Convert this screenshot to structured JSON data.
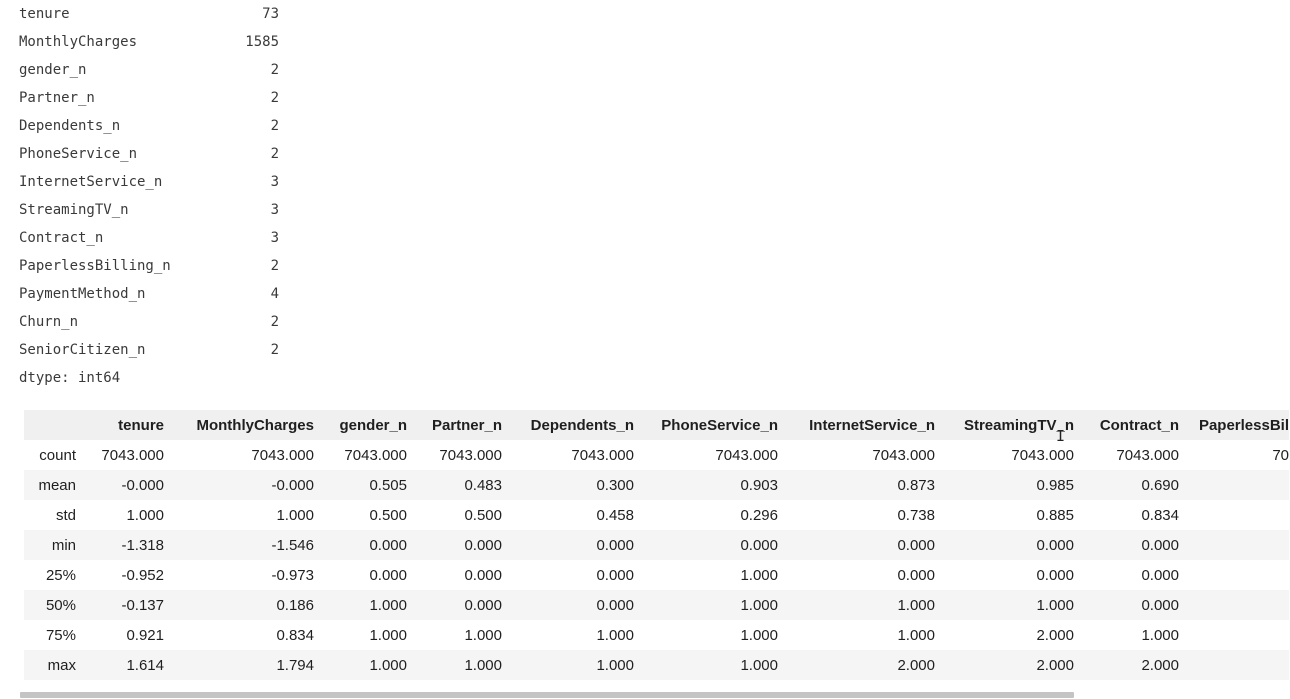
{
  "series_output": {
    "rows": [
      {
        "name": "tenure",
        "value": "73"
      },
      {
        "name": "MonthlyCharges",
        "value": "1585"
      },
      {
        "name": "gender_n",
        "value": "2"
      },
      {
        "name": "Partner_n",
        "value": "2"
      },
      {
        "name": "Dependents_n",
        "value": "2"
      },
      {
        "name": "PhoneService_n",
        "value": "2"
      },
      {
        "name": "InternetService_n",
        "value": "3"
      },
      {
        "name": "StreamingTV_n",
        "value": "3"
      },
      {
        "name": "Contract_n",
        "value": "3"
      },
      {
        "name": "PaperlessBilling_n",
        "value": "2"
      },
      {
        "name": "PaymentMethod_n",
        "value": "4"
      },
      {
        "name": "Churn_n",
        "value": "2"
      },
      {
        "name": "SeniorCitizen_n",
        "value": "2"
      }
    ],
    "dtype": "dtype: int64"
  },
  "dataframe": {
    "columns": [
      "tenure",
      "MonthlyCharges",
      "gender_n",
      "Partner_n",
      "Dependents_n",
      "PhoneService_n",
      "InternetService_n",
      "StreamingTV_n",
      "Contract_n",
      "PaperlessBil"
    ],
    "rows": [
      {
        "index": "count",
        "cells": [
          "7043.000",
          "7043.000",
          "7043.000",
          "7043.000",
          "7043.000",
          "7043.000",
          "7043.000",
          "7043.000",
          "7043.000",
          "70"
        ]
      },
      {
        "index": "mean",
        "cells": [
          "-0.000",
          "-0.000",
          "0.505",
          "0.483",
          "0.300",
          "0.903",
          "0.873",
          "0.985",
          "0.690",
          ""
        ]
      },
      {
        "index": "std",
        "cells": [
          "1.000",
          "1.000",
          "0.500",
          "0.500",
          "0.458",
          "0.296",
          "0.738",
          "0.885",
          "0.834",
          ""
        ]
      },
      {
        "index": "min",
        "cells": [
          "-1.318",
          "-1.546",
          "0.000",
          "0.000",
          "0.000",
          "0.000",
          "0.000",
          "0.000",
          "0.000",
          ""
        ]
      },
      {
        "index": "25%",
        "cells": [
          "-0.952",
          "-0.973",
          "0.000",
          "0.000",
          "0.000",
          "1.000",
          "0.000",
          "0.000",
          "0.000",
          ""
        ]
      },
      {
        "index": "50%",
        "cells": [
          "-0.137",
          "0.186",
          "1.000",
          "0.000",
          "0.000",
          "1.000",
          "1.000",
          "1.000",
          "0.000",
          ""
        ]
      },
      {
        "index": "75%",
        "cells": [
          "0.921",
          "0.834",
          "1.000",
          "1.000",
          "1.000",
          "1.000",
          "1.000",
          "2.000",
          "1.000",
          ""
        ]
      },
      {
        "index": "max",
        "cells": [
          "1.614",
          "1.794",
          "1.000",
          "1.000",
          "1.000",
          "1.000",
          "2.000",
          "2.000",
          "2.000",
          ""
        ]
      }
    ]
  },
  "cursor": {
    "icon": "text-cursor-icon",
    "glyph": "I"
  },
  "colors": {
    "header_bg": "#f0f0f0",
    "stripe_bg": "#f5f5f5",
    "scrollbar": "#c4c4c4"
  }
}
